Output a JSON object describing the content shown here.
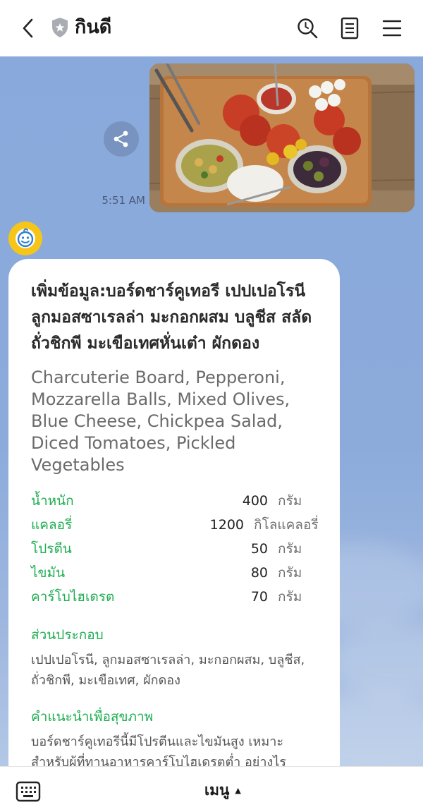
{
  "header": {
    "title": "กินดี",
    "back_icon": "chevron-left-icon",
    "badge_icon": "shield-icon",
    "search_icon": "search-icon",
    "notes_icon": "note-icon",
    "menu_icon": "hamburger-icon"
  },
  "chat": {
    "photo_message": {
      "time": "5:51 AM",
      "share_icon": "share-icon"
    },
    "bot_card": {
      "title": "เพิ่มข้อมูล:บอร์ดชาร์คูเทอรี เปปเปอโรนี ลูกมอสซาเรลล่า มะกอกผสม บลูชีส สลัดถั่วชิกพี มะเขือเทศหั่นเต๋า ผักดอง",
      "subtitle": "Charcuterie Board, Pepperoni, Mozzarella Balls, Mixed Olives, Blue Cheese, Chickpea Salad, Diced Tomatoes, Pickled Vegetables",
      "nutrition": [
        {
          "label": "น้ำหนัก",
          "value": "400",
          "unit": "กรัม"
        },
        {
          "label": "แคลอรี่",
          "value": "1200",
          "unit": "กิโลแคลอรี่"
        },
        {
          "label": "โปรตีน",
          "value": "50",
          "unit": "กรัม"
        },
        {
          "label": "ไขมัน",
          "value": "80",
          "unit": "กรัม"
        },
        {
          "label": "คาร์โบไฮเดรต",
          "value": "70",
          "unit": "กรัม"
        }
      ],
      "ingredients_heading": "ส่วนประกอบ",
      "ingredients_text": "เปปเปอโรนี, ลูกมอสซาเรลล่า, มะกอกผสม, บลูชีส, ถั่วชิกพี, มะเขือเทศ, ผักดอง",
      "advice_heading": "คำแนะนำเพื่อสุขภาพ",
      "advice_text": "บอร์ดชาร์คูเทอรีนี้มีโปรตีนและไขมันสูง เหมาะสำหรับผู้ที่ทานอาหารคาร์โบไฮเดรตต่ำ อย่างไร"
    }
  },
  "bottom_bar": {
    "keyboard_icon": "keyboard-icon",
    "menu_label": "เมนู",
    "caret": "▲"
  },
  "colors": {
    "accent_green": "#1fae52",
    "chat_background": "#8aa8d8",
    "avatar_yellow": "#f5c518"
  }
}
